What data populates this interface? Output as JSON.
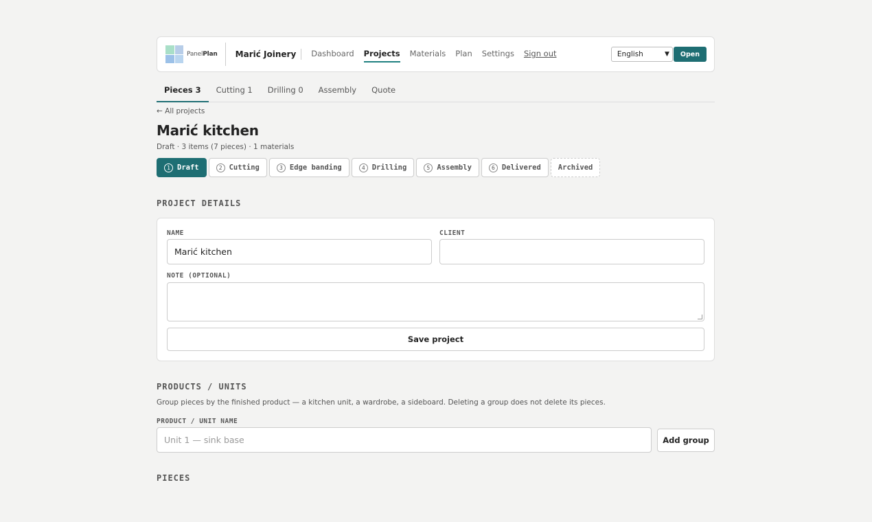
{
  "brand": {
    "logo_text": "Panel",
    "logo_text_bold": "Plan",
    "company": "Marić Joinery"
  },
  "nav": {
    "items": [
      "Dashboard",
      "Projects",
      "Materials",
      "Plan",
      "Settings"
    ],
    "active": "Projects",
    "sign_out": "Sign out"
  },
  "language": {
    "selected": "English",
    "open_label": "Open"
  },
  "tabs": [
    "Pieces 3",
    "Cutting 1",
    "Drilling 0",
    "Assembly",
    "Quote"
  ],
  "back_link": "← All projects",
  "project": {
    "title": "Marić kitchen",
    "meta": "Draft · 3 items (7 pieces) · 1 materials"
  },
  "stages": [
    {
      "num": "1",
      "label": "Draft"
    },
    {
      "num": "2",
      "label": "Cutting"
    },
    {
      "num": "3",
      "label": "Edge banding"
    },
    {
      "num": "4",
      "label": "Drilling"
    },
    {
      "num": "5",
      "label": "Assembly"
    },
    {
      "num": "6",
      "label": "Delivered"
    },
    {
      "num": "",
      "label": "Archived"
    }
  ],
  "details": {
    "section_title": "PROJECT DETAILS",
    "name_label": "NAME",
    "name_value": "Marić kitchen",
    "client_label": "CLIENT",
    "client_value": "",
    "note_label": "NOTE (OPTIONAL)",
    "note_value": "",
    "save_label": "Save project"
  },
  "products": {
    "section_title": "PRODUCTS / UNITS",
    "help": "Group pieces by the finished product — a kitchen unit, a wardrobe, a sideboard. Deleting a group does not delete its pieces.",
    "name_label": "PRODUCT / UNIT NAME",
    "placeholder": "Unit 1 — sink base",
    "add_label": "Add group"
  },
  "pieces": {
    "section_title": "PIECES"
  }
}
